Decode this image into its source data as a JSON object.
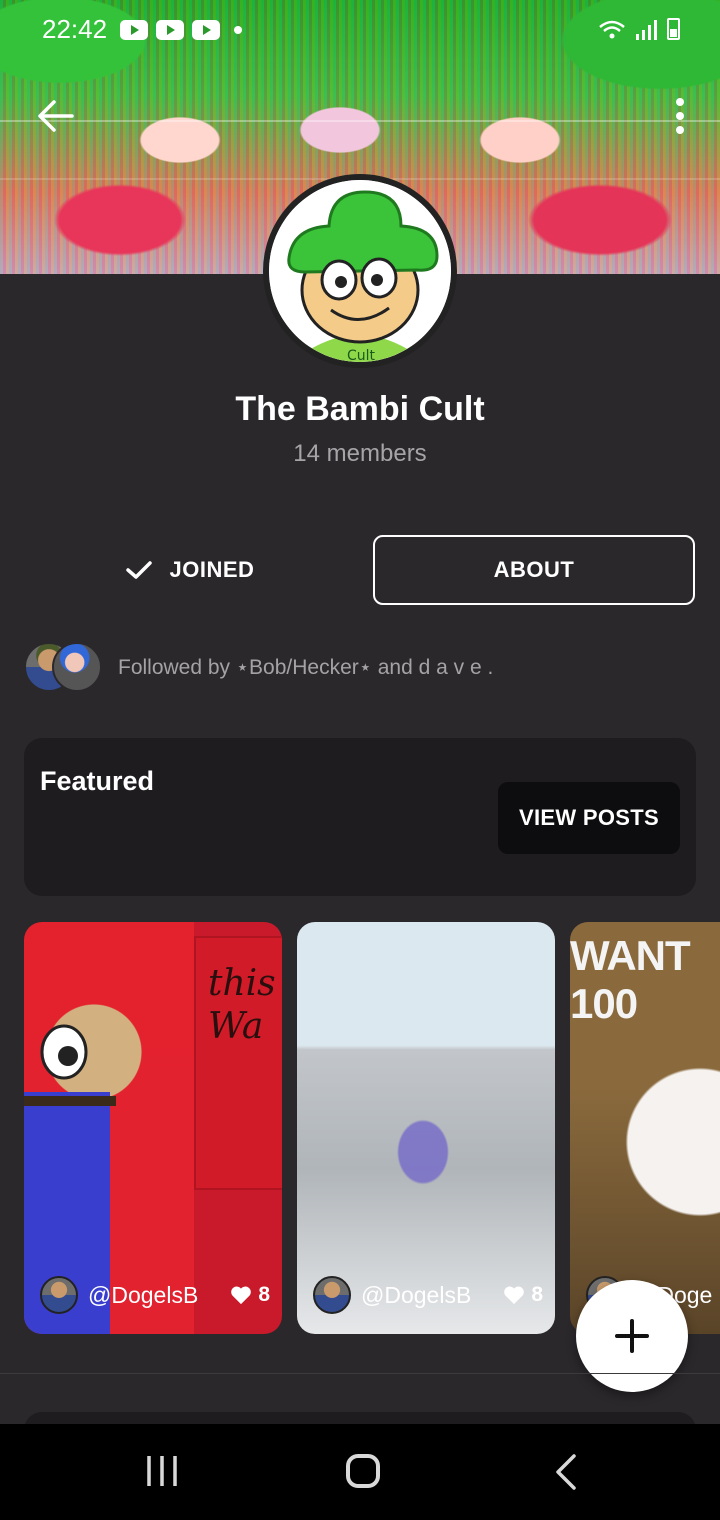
{
  "status_bar": {
    "time": "22:42",
    "icons": [
      "youtube-icon",
      "youtube-icon",
      "youtube-icon",
      "dot",
      "wifi-icon",
      "signal-icon",
      "battery-icon"
    ]
  },
  "header": {
    "back_icon": "arrow-left-icon",
    "more_icon": "more-vertical-icon"
  },
  "community": {
    "title": "The Bambi Cult",
    "members": "14 members",
    "avatar_text": "Cult"
  },
  "actions": {
    "joined_label": "JOINED",
    "about_label": "ABOUT"
  },
  "followers": {
    "text": "Followed by ⋆Bob/Hecker⋆ and d a v e ."
  },
  "featured": {
    "title": "Featured",
    "view_posts_label": "VIEW POSTS"
  },
  "posts": [
    {
      "user": "@DogelsB",
      "likes": "8",
      "image_text": "this Wa"
    },
    {
      "user": "@DogelsB",
      "likes": "8",
      "image_text": ""
    },
    {
      "user": "@Doge",
      "likes": "",
      "image_text": "WANT 100"
    }
  ],
  "fab": {
    "icon": "plus-icon"
  },
  "nav": {
    "icons": [
      "recents-icon",
      "home-icon",
      "back-icon"
    ]
  },
  "colors": {
    "background": "#2b282c",
    "card": "#1f1c20",
    "muted_text": "#a7a4a8",
    "accent": "#ffffff"
  }
}
